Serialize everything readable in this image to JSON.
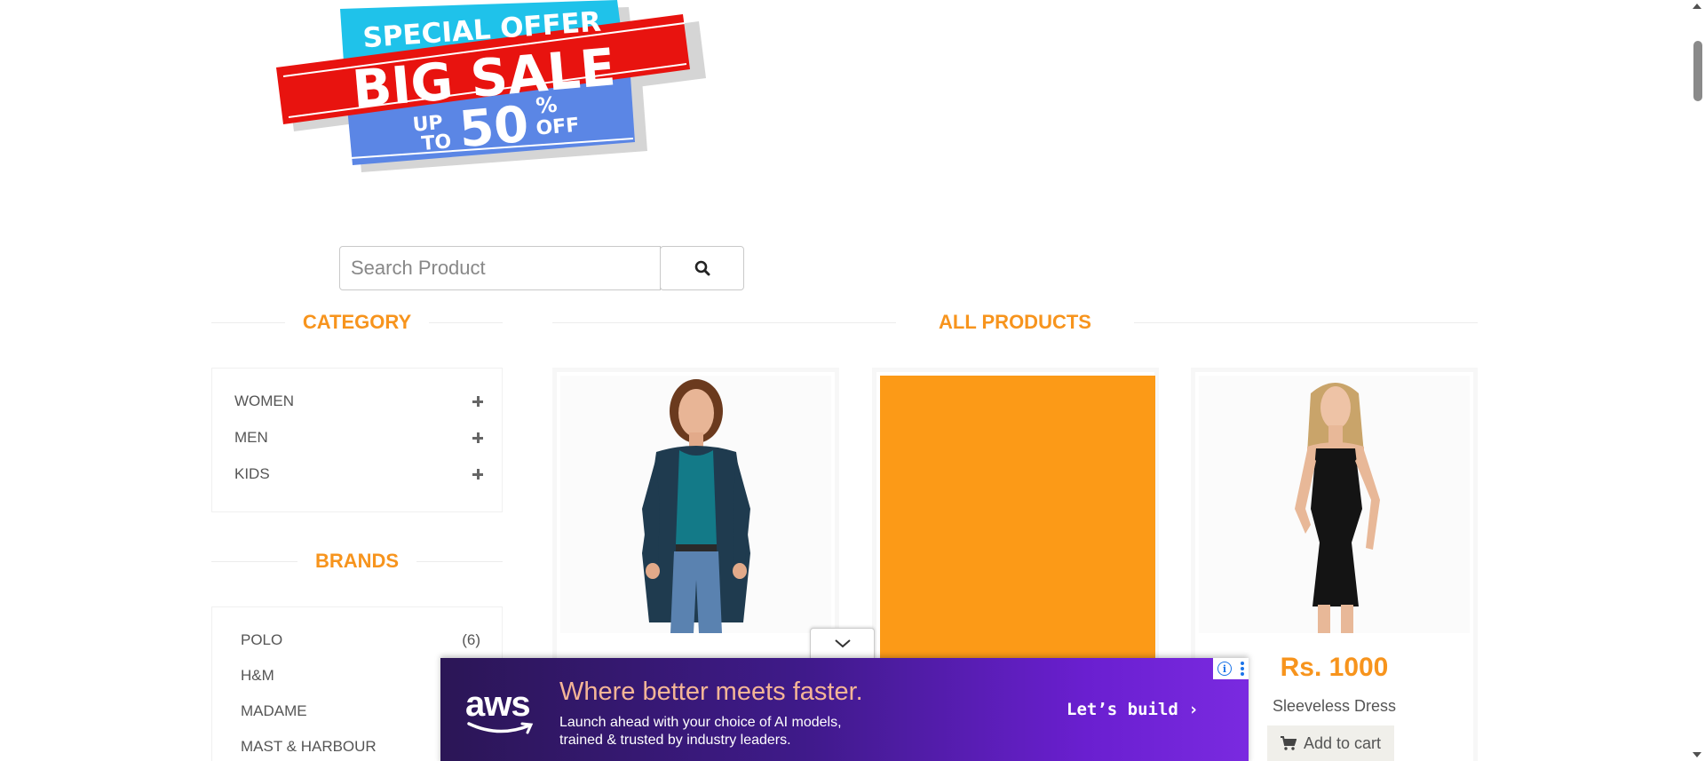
{
  "banner": {
    "line1": "SPECIAL OFFER",
    "line2": "BIG SALE",
    "line3_up": "UP",
    "line3_to": "TO",
    "line3_num": "50",
    "line3_pct": "%",
    "line3_off": "OFF"
  },
  "search": {
    "placeholder": "Search Product",
    "icon": "search-icon"
  },
  "category": {
    "title": "CATEGORY",
    "items": [
      {
        "label": "WOMEN",
        "icon": "plus-icon"
      },
      {
        "label": "MEN",
        "icon": "plus-icon"
      },
      {
        "label": "KIDS",
        "icon": "plus-icon"
      }
    ]
  },
  "brands": {
    "title": "BRANDS",
    "items": [
      {
        "label": "POLO",
        "count": "(6)"
      },
      {
        "label": "H&M",
        "count": ""
      },
      {
        "label": "MADAME",
        "count": ""
      },
      {
        "label": "MAST & HARBOUR",
        "count": ""
      }
    ]
  },
  "products": {
    "title": "ALL PRODUCTS",
    "items": [
      {
        "image": "woman-in-navy-cardigan-photo"
      },
      {
        "image": "orange-placeholder",
        "color": "#fc9a17"
      },
      {
        "image": "woman-in-black-dress-photo",
        "price": "Rs. 1000",
        "name": "Sleeveless Dress",
        "cart_label": "Add to cart",
        "cart_icon": "shopping-cart-icon"
      }
    ]
  },
  "ad": {
    "collapse_icon": "chevron-down-icon",
    "logo": "aws",
    "headline": "Where better meets faster.",
    "sub_line1": "Launch ahead with your choice of AI models,",
    "sub_line2": "trained & trusted by industry leaders.",
    "cta": "Let’s build ›",
    "info_glyph": "i"
  },
  "colors": {
    "accent": "#f7941d",
    "orange_block": "#fc9a17",
    "banner_red": "#e8130f",
    "banner_cyan": "#1fc2ea",
    "banner_blue": "#5b86e5"
  }
}
